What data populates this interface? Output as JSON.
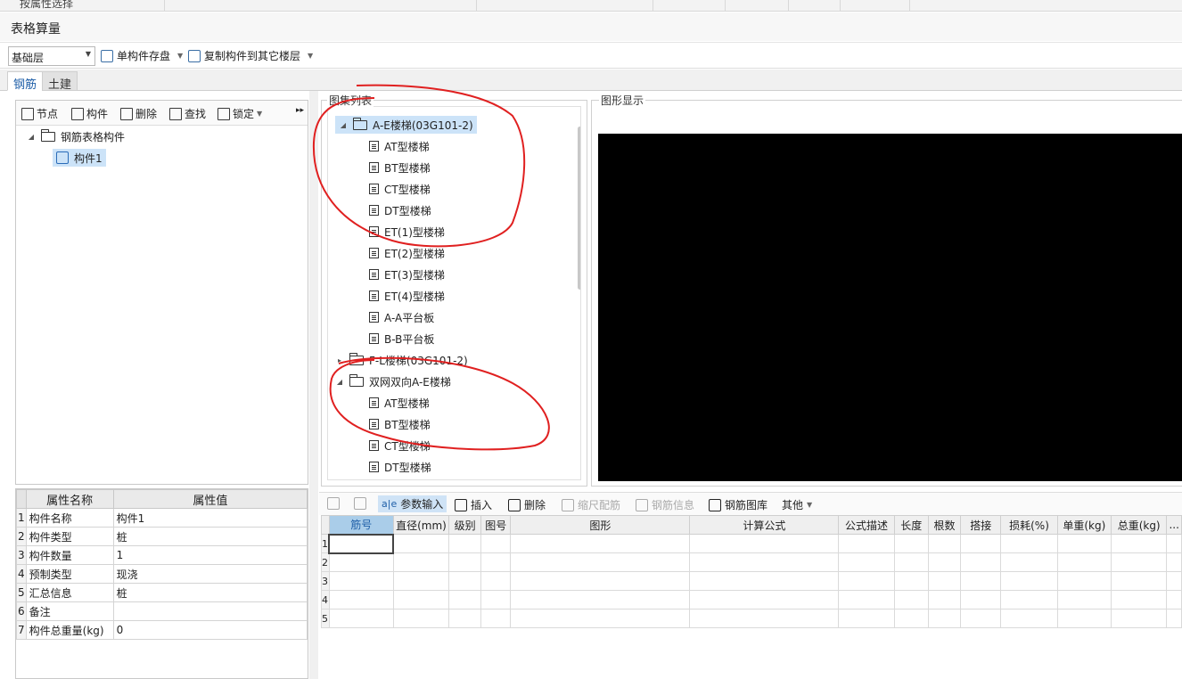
{
  "window": {
    "top_strip_label": "按属性选择",
    "title": "表格算量"
  },
  "toolbar": {
    "floor_value": "基础层",
    "single_save_label": "单构件存盘",
    "copy_to_floor_label": "复制构件到其它楼层"
  },
  "module_tabs": [
    {
      "label": "钢筋"
    },
    {
      "label": "土建"
    }
  ],
  "component_toolbar": {
    "node_label": "节点",
    "component_label": "构件",
    "delete_label": "删除",
    "find_label": "查找",
    "lock_label": "锁定",
    "more_label": "▸▸"
  },
  "component_tree": {
    "root_label": "钢筋表格构件",
    "child_label": "构件1"
  },
  "properties": {
    "header_name": "属性名称",
    "header_value": "属性值",
    "rows": [
      {
        "idx": "1",
        "name": "构件名称",
        "value": "构件1"
      },
      {
        "idx": "2",
        "name": "构件类型",
        "value": "桩"
      },
      {
        "idx": "3",
        "name": "构件数量",
        "value": "1"
      },
      {
        "idx": "4",
        "name": "预制类型",
        "value": "现浇"
      },
      {
        "idx": "5",
        "name": "汇总信息",
        "value": "桩"
      },
      {
        "idx": "6",
        "name": "备注",
        "value": ""
      },
      {
        "idx": "7",
        "name": "构件总重量(kg)",
        "value": "0"
      }
    ]
  },
  "atlas": {
    "group_label": "图集列表",
    "groups": [
      {
        "label": "A-E楼梯(03G101-2)",
        "expanded": true,
        "selected": true,
        "items": [
          "AT型楼梯",
          "BT型楼梯",
          "CT型楼梯",
          "DT型楼梯",
          "ET(1)型楼梯",
          "ET(2)型楼梯",
          "ET(3)型楼梯",
          "ET(4)型楼梯",
          "A-A平台板",
          "B-B平台板"
        ]
      },
      {
        "label": "F-L楼梯(03G101-2)",
        "expanded": false,
        "selected": false,
        "items": []
      },
      {
        "label": "双网双向A-E楼梯",
        "expanded": true,
        "selected": false,
        "items": [
          "AT型楼梯",
          "BT型楼梯",
          "CT型楼梯",
          "DT型楼梯"
        ]
      }
    ]
  },
  "graphic": {
    "group_label": "图形显示"
  },
  "grid_toolbar": {
    "up_label": "",
    "down_label": "",
    "param_input_label": "参数输入",
    "insert_label": "插入",
    "delete_label": "删除",
    "scale_label": "缩尺配筋",
    "rebar_info_label": "钢筋信息",
    "rebar_library_label": "钢筋图库",
    "other_label": "其他"
  },
  "rebar_grid": {
    "columns": [
      "筋号",
      "直径(mm)",
      "级别",
      "图号",
      "图形",
      "计算公式",
      "公式描述",
      "长度",
      "根数",
      "搭接",
      "损耗(%)",
      "单重(kg)",
      "总重(kg)",
      "..."
    ],
    "rows": [
      "1",
      "2",
      "3",
      "4",
      "5"
    ]
  },
  "colors": {
    "annotation_red": "#e02020",
    "selected_blue": "#cce3f8",
    "canvas_black": "#000000"
  }
}
